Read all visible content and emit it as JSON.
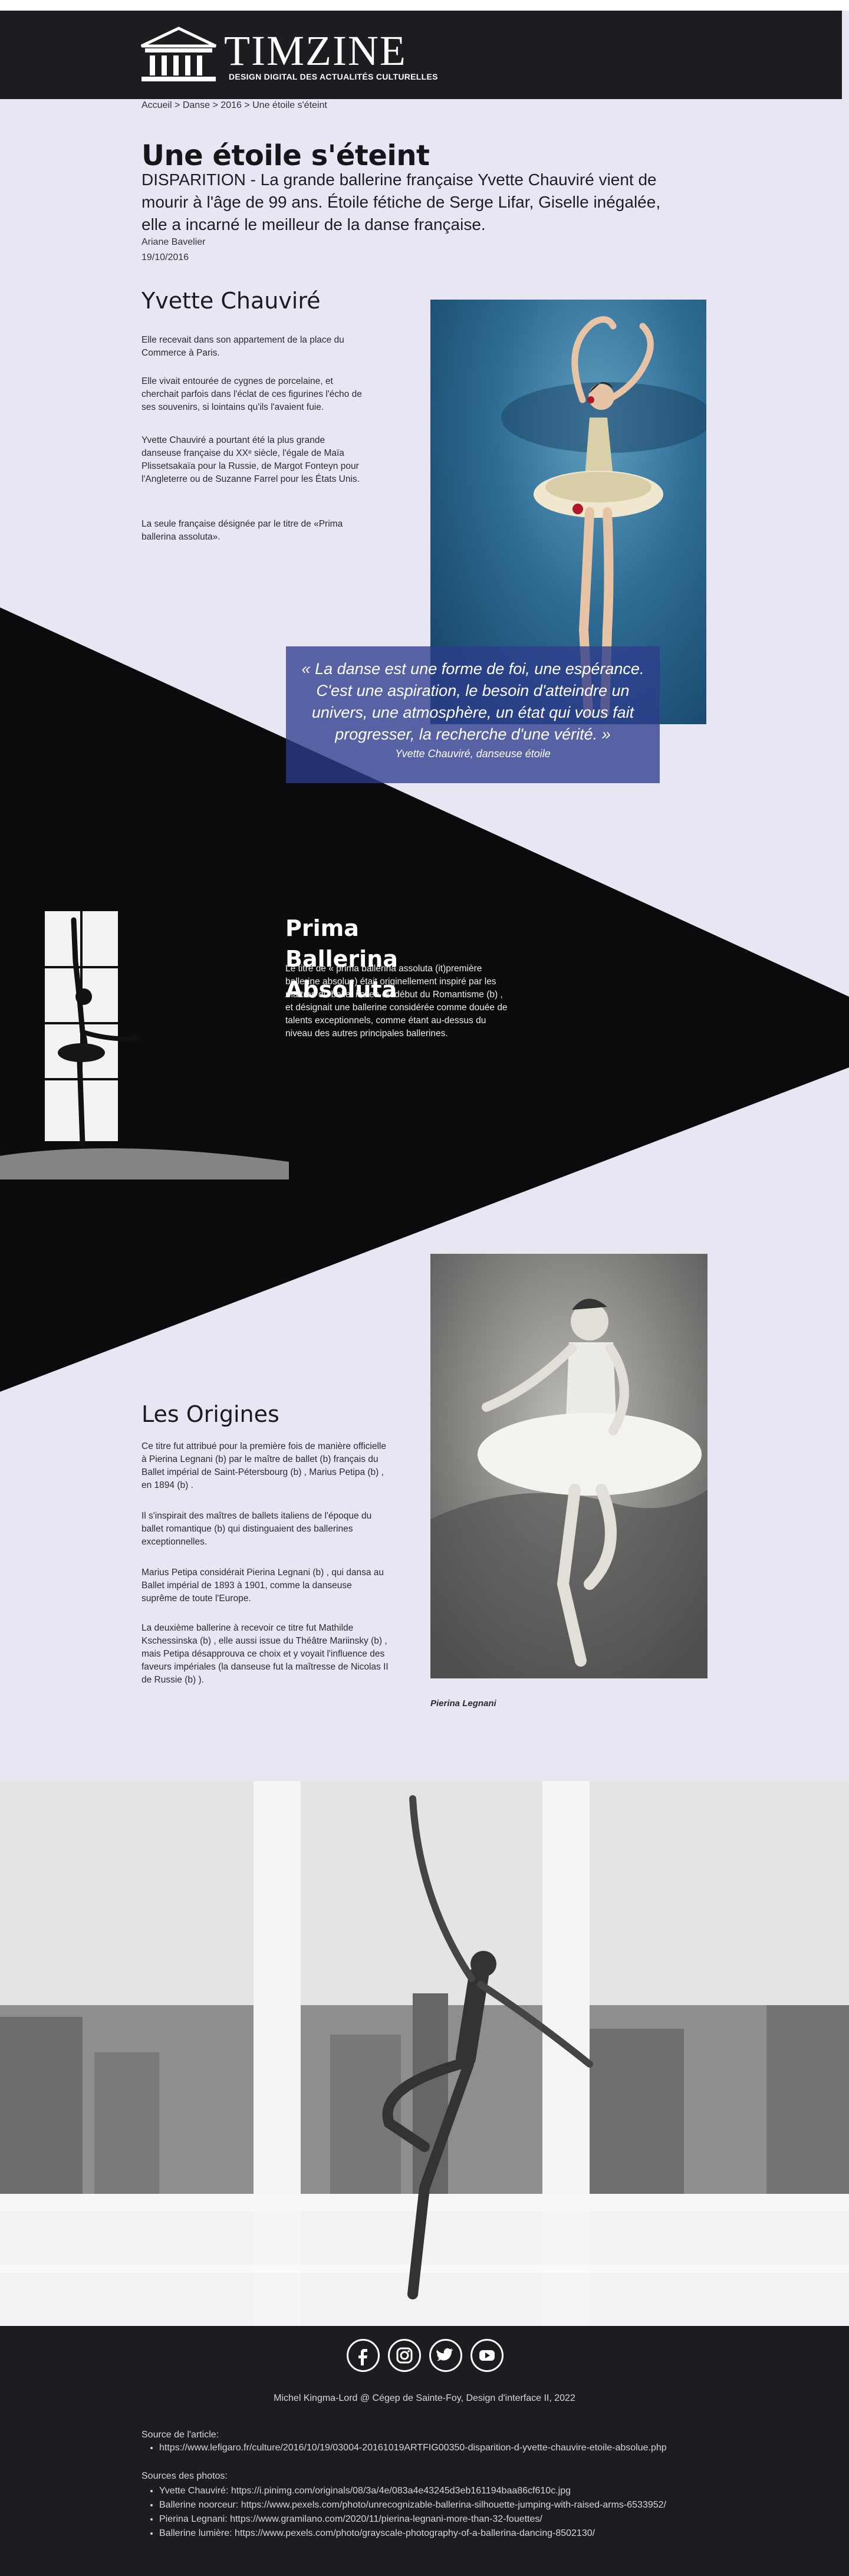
{
  "header": {
    "logo_word": "TIMZINE",
    "logo_tagline": "DESIGN DIGITAL DES ACTUALITÉS CULTURELLES"
  },
  "breadcrumb": {
    "items": [
      "Accueil",
      "Danse",
      "2016",
      "Une étoile s'éteint"
    ],
    "separator": " > "
  },
  "article": {
    "title": "Une étoile s'éteint",
    "lede": "DISPARITION - La grande ballerine française Yvette Chauviré vient de mourir à l'âge de 99 ans. Étoile fétiche de Serge Lifar, Giselle inégalée, elle a incarné le meilleur de la danse française.",
    "author": "Ariane Bavelier",
    "date": "19/10/2016"
  },
  "section_yvette": {
    "heading": "Yvette Chauviré",
    "paragraphs": [
      "Elle recevait dans son appartement de la place du Commerce à Paris.",
      "Elle vivait entourée de cygnes de porcelaine, et cherchait parfois dans l'éclat de ces figurines l'écho de ses souvenirs, si lointains qu'ils l'avaient fuie.",
      "Yvette Chauviré a pourtant été la plus grande danseuse française du XXᵉ siècle, l'égale de Maïa Plissetsakaïa pour la Russie, de Margot Fonteyn pour l'Angleterre ou de Suzanne Farrel pour les États Unis.",
      "La seule française désignée par le titre de «Prima ballerina assoluta»."
    ]
  },
  "quote": {
    "text": "« La danse est une forme de foi, une espérance. C'est une aspiration, le besoin d'atteindre un univers, une atmosphère, un état qui vous fait progresser, la recherche d'une vérité. »",
    "author": "Yvette Chauviré, danseuse étoile"
  },
  "section_prima": {
    "heading": "Prima Ballerina Absoluta",
    "paragraph": "Le titre de « prima ballerina assoluta (it)première ballerine absolue) était originellement inspiré par les maîtres du ballet italien du début du Romantisme (b) , et désignait une ballerine considérée comme douée de talents exceptionnels, comme étant au-dessus du niveau des autres principales ballerines."
  },
  "section_origines": {
    "heading": "Les Origines",
    "paragraphs": [
      "Ce titre fut attribué pour la première fois de manière officielle à Pierina Legnani (b) par le maître de ballet (b) français du Ballet impérial de Saint-Pétersbourg (b) , Marius Petipa (b) , en 1894 (b) .",
      "Il s'inspirait des maîtres de ballets italiens de l'époque du ballet romantique (b) qui distinguaient des ballerines exceptionnelles.",
      "Marius Petipa considérait Pierina Legnani (b) , qui dansa au Ballet impérial de 1893 à 1901, comme la danseuse suprême de toute l'Europe.",
      "La deuxième ballerine à recevoir ce titre fut Mathilde Kschessinska (b) , elle aussi issue du Théâtre Mariinsky (b) , mais Petipa désapprouva ce choix et y voyait l'influence des faveurs impériales (la danseuse fut la maîtresse de Nicolas II de Russie (b) )."
    ],
    "photo_caption": "Pierina Legnani"
  },
  "footer": {
    "social_icons": [
      "facebook-icon",
      "instagram-icon",
      "twitter-icon",
      "youtube-icon"
    ],
    "credit": "Michel Kingma-Lord @ Cégep de Sainte-Foy, Design d'interface II, 2022",
    "source_heading": "Source de l'article:",
    "source_items": [
      "https://www.lefigaro.fr/culture/2016/10/19/03004-20161019ARTFIG00350-disparition-d-yvette-chauvire-etoile-absolue.php"
    ],
    "photos_heading": "Sources des photos:",
    "photos_items": [
      "Yvette Chauviré:  https://i.pinimg.com/originals/08/3a/4e/083a4e43245d3eb161194baa86cf610c.jpg",
      "Ballerine noorceur: https://www.pexels.com/photo/unrecognizable-ballerina-silhouette-jumping-with-raised-arms-6533952/",
      "Pierina Legnani: https://www.gramilano.com/2020/11/pierina-legnani-more-than-32-fouettes/",
      "Ballerine lumière: https://www.pexels.com/photo/grayscale-photography-of-a-ballerina-dancing-8502130/"
    ]
  },
  "colors": {
    "header_bg": "#1c1d21",
    "page_bg": "#e9e6f3",
    "quote_bg": "#2d3c8c"
  }
}
